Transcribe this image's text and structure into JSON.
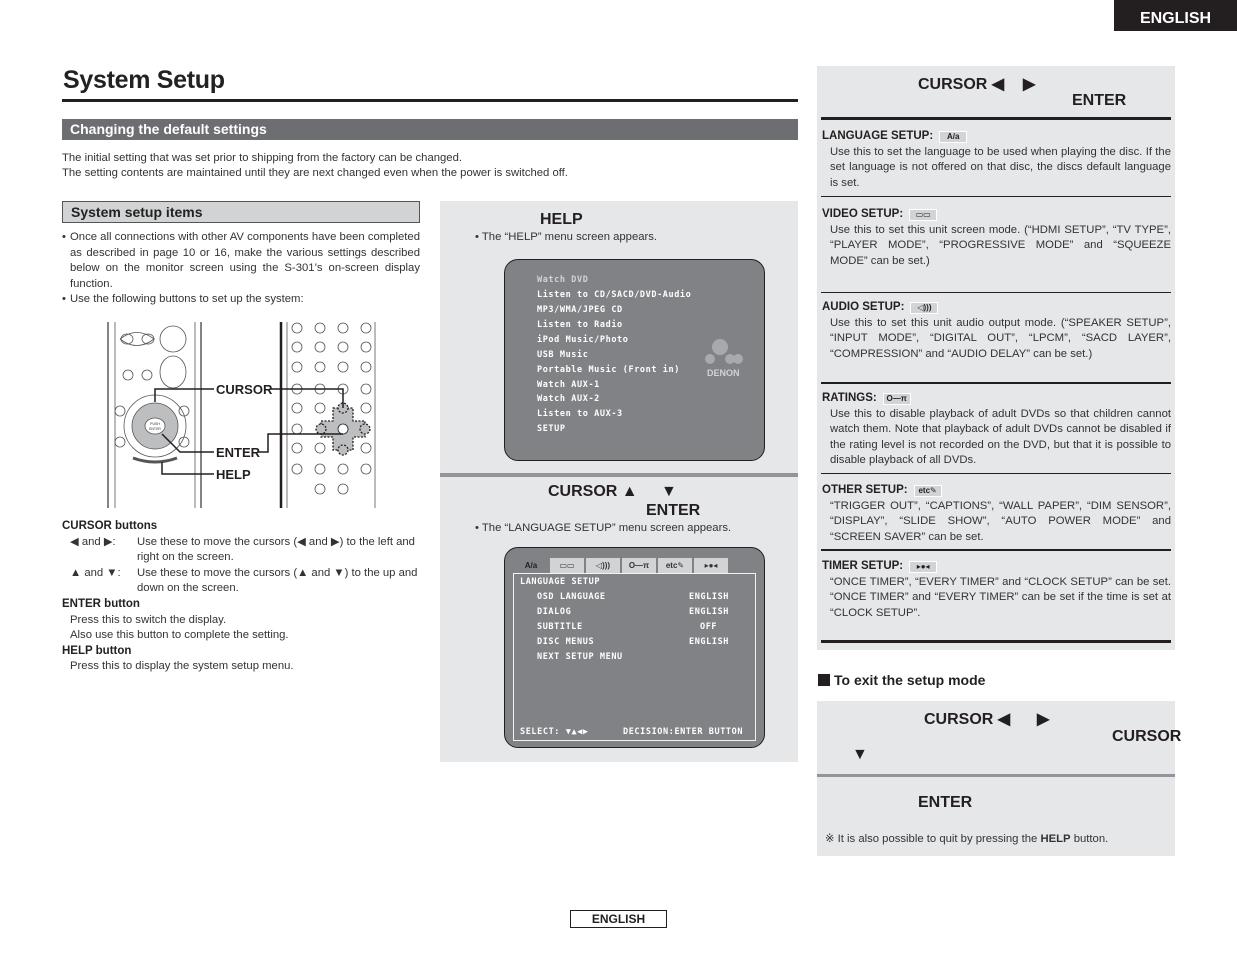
{
  "header": {
    "language_tab": "ENGLISH",
    "title": "System Setup"
  },
  "section": {
    "title": "Changing the default settings",
    "intro": [
      "The initial setting that was set prior to shipping from the factory can be changed.",
      "The setting contents are maintained until they are next changed even when the power is switched off."
    ]
  },
  "setup_items": {
    "title": "System setup items",
    "bullets": [
      "Once all connections with other AV components have been completed as described in page 10 or 16, make the various settings described below on the monitor screen using the S-301’s on-screen display function.",
      "Use the following buttons to set up the system:"
    ],
    "figure_labels": {
      "cursor": "CURSOR",
      "enter": "ENTER",
      "help": "HELP",
      "push_enter": "PUSH ENTER"
    }
  },
  "button_descriptions": {
    "cursor_title": "CURSOR buttons",
    "lr_key": "◀ and ▶:",
    "lr_desc": "Use these to move the cursors (◀ and ▶) to the left and right on the screen.",
    "ud_key": "▲ and ▼:",
    "ud_desc": "Use these to move the cursors (▲ and ▼) to the up and down on the screen.",
    "enter_title": "ENTER button",
    "enter_desc": [
      "Press this to switch the display.",
      "Also use this button to complete the setting."
    ],
    "help_title": "HELP button",
    "help_desc": "Press this to display the system setup menu."
  },
  "steps": {
    "step1": {
      "label": "HELP",
      "note": "• The “HELP” menu screen appears."
    },
    "step2": {
      "label_cursor": "CURSOR ▲",
      "label_down": "▼",
      "label_enter": "ENTER",
      "note": "• The “LANGUAGE SETUP” menu screen appears."
    }
  },
  "help_menu": {
    "items": [
      "Watch DVD",
      "Listen to CD/SACD/DVD-Audio",
      "MP3/WMA/JPEG CD",
      "Listen to Radio",
      "iPod Music/Photo",
      "USB Music",
      "Portable Music (Front in)",
      "Watch AUX-1",
      "Watch AUX-2",
      "Listen to AUX-3",
      "SETUP"
    ],
    "logo": "DENON"
  },
  "language_osd": {
    "tabs": [
      "A/a",
      "▭▭",
      "◁)))",
      "O—π",
      "etc✎",
      "▸●◂"
    ],
    "title": "LANGUAGE SETUP",
    "rows": [
      {
        "label": "OSD LANGUAGE",
        "value": "ENGLISH"
      },
      {
        "label": "DIALOG",
        "value": "ENGLISH"
      },
      {
        "label": "SUBTITLE",
        "value": "OFF"
      },
      {
        "label": "DISC MENUS",
        "value": "ENGLISH"
      },
      {
        "label": "NEXT SETUP MENU",
        "value": ""
      }
    ],
    "footer_select": "SELECT: ▼▲◀▶",
    "footer_decision": "DECISION:ENTER BUTTON"
  },
  "right_panel": {
    "step_cursor": "CURSOR ◀",
    "step_right": "▶",
    "step_enter": "ENTER",
    "entries": [
      {
        "title": "LANGUAGE SETUP:",
        "icon": "A/a",
        "text": "Use this to set the language to be used when playing the disc. If the set language is not offered on that disc, the discs default language is set."
      },
      {
        "title": "VIDEO SETUP:",
        "icon": "▭▭",
        "text": "Use this to set this unit screen mode. (“HDMI SETUP”, “TV TYPE”, “PLAYER MODE”, “PROGRESSIVE MODE” and “SQUEEZE MODE” can be set.)"
      },
      {
        "title": "AUDIO SETUP:",
        "icon": "◁)))",
        "text": "Use this to set this unit audio output mode. (“SPEAKER SETUP”, “INPUT MODE”, “DIGITAL OUT”, “LPCM”, “SACD LAYER”, “COMPRESSION” and “AUDIO DELAY” can be set.)"
      },
      {
        "title": "RATINGS:",
        "icon": "O—π",
        "text": "Use this to disable playback of adult DVDs so that children cannot watch them. Note that playback of adult DVDs cannot be disabled if the rating level is not recorded on the DVD, but that it is possible to disable playback of all DVDs."
      },
      {
        "title": "OTHER SETUP:",
        "icon": "etc✎",
        "text": "“TRIGGER OUT”, “CAPTIONS”, “WALL PAPER”, “DIM SENSOR”, “DISPLAY”, “SLIDE SHOW”, “AUTO POWER MODE” and “SCREEN SAVER” can be set."
      },
      {
        "title": "TIMER SETUP:",
        "icon": "▸●◂",
        "text": "“ONCE TIMER”, “EVERY TIMER” and “CLOCK SETUP” can be set. “ONCE TIMER” and “EVERY TIMER” can be set if the time is set at “CLOCK SETUP”."
      }
    ]
  },
  "exit": {
    "title": "To exit the setup mode",
    "step_cursor": "CURSOR ◀",
    "step_right": "▶",
    "step_cursor2": "CURSOR",
    "step_down": "▼",
    "step_enter": "ENTER",
    "note_prefix": "※ It is also possible to quit by pressing the ",
    "note_bold": "HELP",
    "note_suffix": " button."
  },
  "footer": {
    "language": "ENGLISH"
  }
}
